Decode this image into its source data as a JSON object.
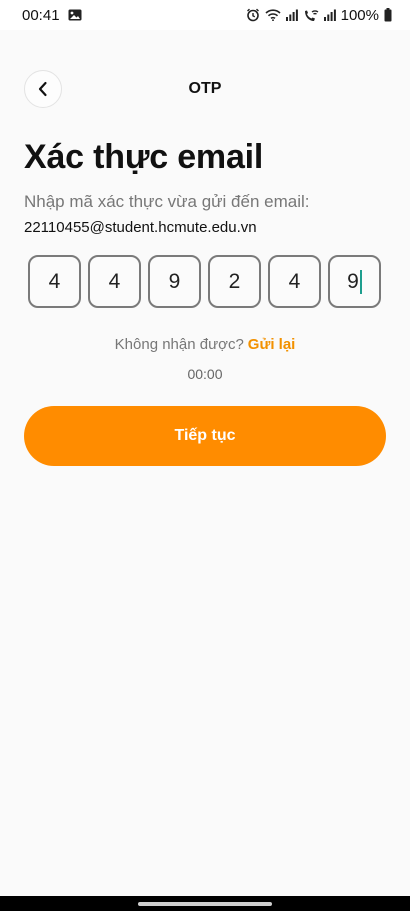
{
  "status_bar": {
    "time": "00:41",
    "battery_percent": "100%",
    "icons_left": [
      "image-icon"
    ],
    "icons_right": [
      "alarm-icon",
      "wifi-icon",
      "signal-icon",
      "wifi-calling-icon",
      "signal-icon-2",
      "battery-icon"
    ]
  },
  "header": {
    "title": "OTP",
    "back_icon": "chevron-left-icon"
  },
  "main": {
    "page_title": "Xác thực email",
    "subtitle": "Nhập mã xác thực vừa gửi đến email:",
    "email": "22110455@student.hcmute.edu.vn",
    "otp_digits": [
      "4",
      "4",
      "9",
      "2",
      "4",
      "9"
    ],
    "resend_prompt": "Không nhận được?",
    "resend_link": "Gửi lại",
    "timer": "00:00",
    "continue_label": "Tiếp tục"
  },
  "colors": {
    "accent": "#ff8c00",
    "link": "#f29100",
    "caret": "#1e9e8e"
  }
}
